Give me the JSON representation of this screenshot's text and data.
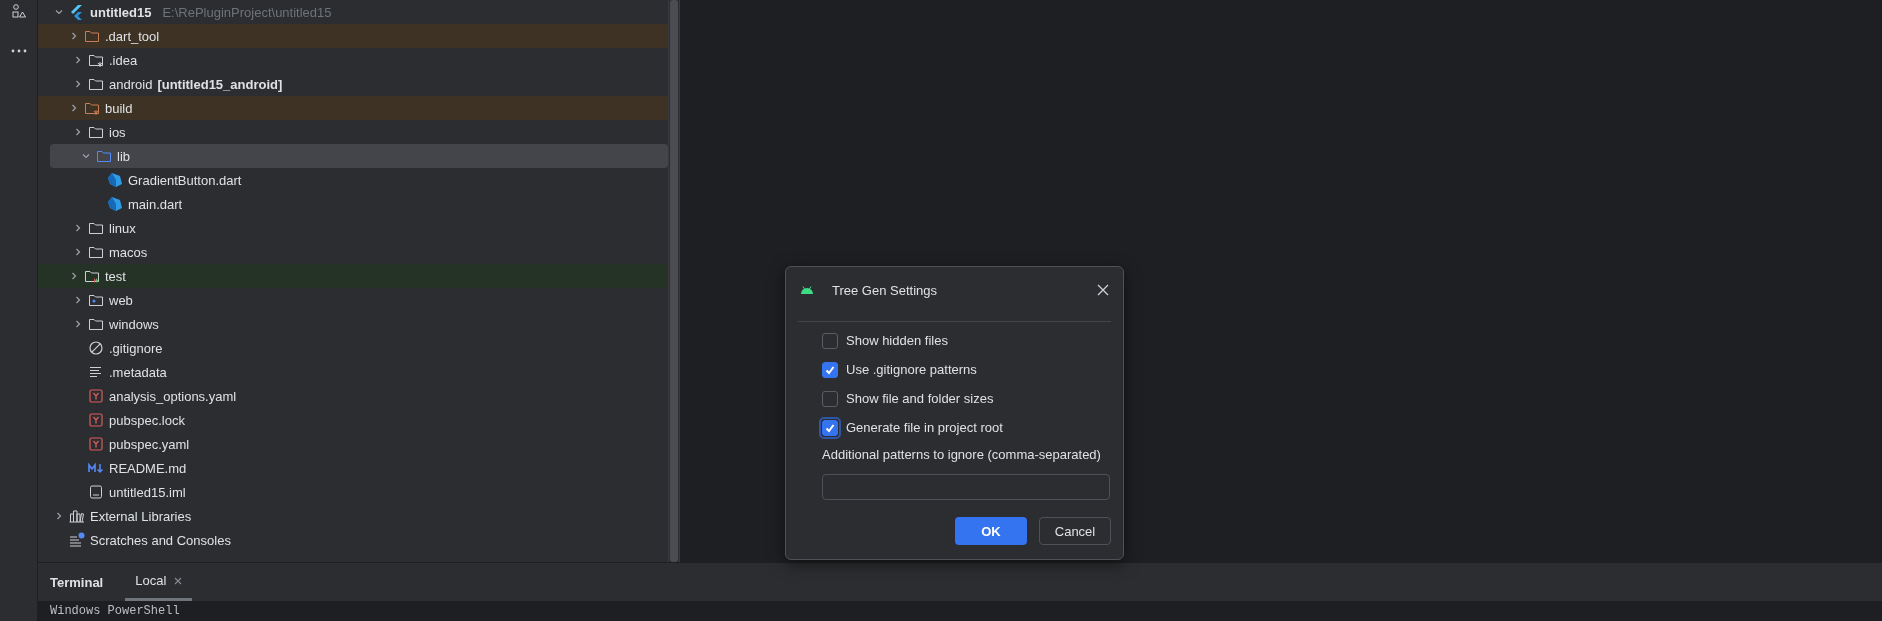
{
  "project_tree": {
    "root": {
      "name": "untitled15",
      "path": "E:\\RePluginProject\\untitled15",
      "expanded": true,
      "children": [
        {
          "name": ".dart_tool",
          "kind": "folder-excluded",
          "expanded": false,
          "excluded": true,
          "test": false,
          "selected": false
        },
        {
          "name": ".idea",
          "kind": "folder-config",
          "expanded": false,
          "excluded": false,
          "test": false,
          "selected": false
        },
        {
          "name": "android",
          "module": "[untitled15_android]",
          "kind": "folder",
          "expanded": false,
          "excluded": false,
          "test": false,
          "selected": false
        },
        {
          "name": "build",
          "kind": "folder-excluded-config",
          "expanded": false,
          "excluded": true,
          "test": false,
          "selected": false
        },
        {
          "name": "ios",
          "kind": "folder",
          "expanded": false,
          "excluded": false,
          "test": false,
          "selected": false
        },
        {
          "name": "lib",
          "kind": "folder-source",
          "expanded": true,
          "excluded": false,
          "test": false,
          "selected": true,
          "children": [
            {
              "name": "GradientButton.dart",
              "kind": "dart",
              "excluded": false,
              "test": false,
              "selected": false
            },
            {
              "name": "main.dart",
              "kind": "dart",
              "excluded": false,
              "test": false,
              "selected": false
            }
          ]
        },
        {
          "name": "linux",
          "kind": "folder",
          "expanded": false,
          "excluded": false,
          "test": false,
          "selected": false
        },
        {
          "name": "macos",
          "kind": "folder",
          "expanded": false,
          "excluded": false,
          "test": false,
          "selected": false
        },
        {
          "name": "test",
          "kind": "folder-test",
          "expanded": false,
          "excluded": false,
          "test": true,
          "selected": false
        },
        {
          "name": "web",
          "kind": "folder-web",
          "expanded": false,
          "excluded": false,
          "test": false,
          "selected": false
        },
        {
          "name": "windows",
          "kind": "folder",
          "expanded": false,
          "excluded": false,
          "test": false,
          "selected": false
        },
        {
          "name": ".gitignore",
          "kind": "gitignore",
          "excluded": false,
          "test": false,
          "selected": false
        },
        {
          "name": ".metadata",
          "kind": "text",
          "excluded": false,
          "test": false,
          "selected": false
        },
        {
          "name": "analysis_options.yaml",
          "kind": "yaml",
          "excluded": false,
          "test": false,
          "selected": false
        },
        {
          "name": "pubspec.lock",
          "kind": "yaml",
          "excluded": false,
          "test": false,
          "selected": false
        },
        {
          "name": "pubspec.yaml",
          "kind": "yaml",
          "excluded": false,
          "test": false,
          "selected": false
        },
        {
          "name": "README.md",
          "kind": "markdown",
          "excluded": false,
          "test": false,
          "selected": false
        },
        {
          "name": "untitled15.iml",
          "kind": "iml",
          "excluded": false,
          "test": false,
          "selected": false
        }
      ]
    },
    "extra": [
      {
        "name": "External Libraries",
        "kind": "libraries",
        "expanded": false,
        "selected": false
      },
      {
        "name": "Scratches and Consoles",
        "kind": "scratches",
        "selected": false
      }
    ]
  },
  "dialog": {
    "title": "Tree Gen Settings",
    "options": [
      {
        "label": "Show hidden files",
        "checked": false,
        "focused": false
      },
      {
        "label": "Use .gitignore patterns",
        "checked": true,
        "focused": false
      },
      {
        "label": "Show file and folder sizes",
        "checked": false,
        "focused": false
      },
      {
        "label": "Generate file in project root",
        "checked": true,
        "focused": true
      }
    ],
    "field_label": "Additional patterns to ignore (comma-separated)",
    "buttons": [
      {
        "label": "OK",
        "kind": "primary"
      },
      {
        "label": "Cancel",
        "kind": "secondary"
      }
    ]
  },
  "terminal": {
    "title": "Terminal",
    "tabs": [
      {
        "label": "Local",
        "selected": true
      }
    ],
    "output": "Windows PowerShell"
  }
}
